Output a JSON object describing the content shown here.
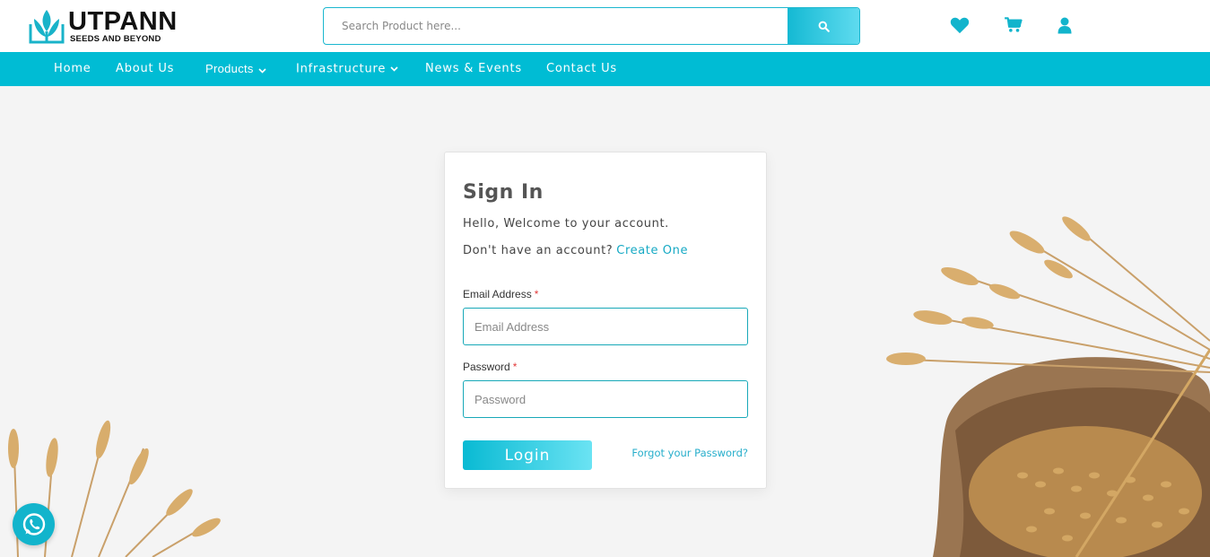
{
  "brand": {
    "name": "UTPANN",
    "tagline": "SEEDS AND BEYOND"
  },
  "search": {
    "placeholder": "Search Product here...",
    "button_icon": "search-icon"
  },
  "header_icons": [
    "heart-icon",
    "cart-icon",
    "user-icon"
  ],
  "nav": {
    "items": [
      {
        "label": "Home",
        "has_dropdown": false
      },
      {
        "label": "About Us",
        "has_dropdown": false
      },
      {
        "label": "Products",
        "has_dropdown": true
      },
      {
        "label": "Infrastructure",
        "has_dropdown": true
      },
      {
        "label": "News & Events",
        "has_dropdown": false
      },
      {
        "label": "Contact Us",
        "has_dropdown": false
      }
    ]
  },
  "signin": {
    "title": "Sign In",
    "welcome": "Hello, Welcome to your account.",
    "no_account_text": "Don't have an account?",
    "create_link": "Create One",
    "email_label": "Email Address",
    "email_placeholder": "Email Address",
    "password_label": "Password",
    "password_placeholder": "Password",
    "required_mark": "*",
    "login_label": "Login",
    "forgot_label": "Forgot your Password?"
  },
  "colors": {
    "accent": "#00bcd4",
    "link": "#15a9c4",
    "required": "#e23a3a",
    "background": "#f4f4f4"
  },
  "floating": {
    "whatsapp_icon": "whatsapp-icon"
  }
}
